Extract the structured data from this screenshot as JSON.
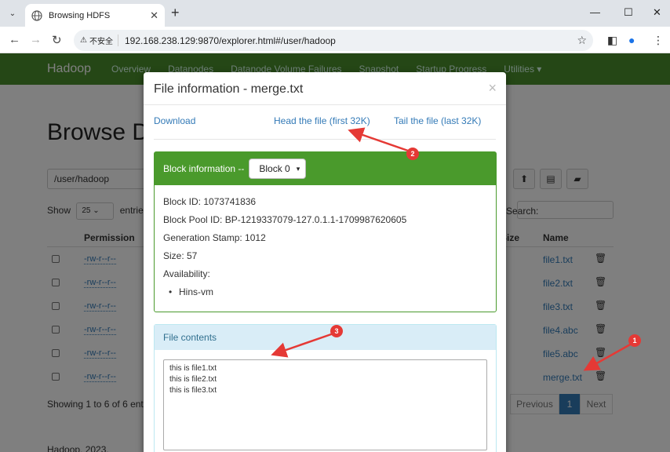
{
  "browser": {
    "tab_title": "Browsing HDFS",
    "new_tab": "+",
    "warning": "不安全",
    "url": "192.168.238.129:9870/explorer.html#/user/hadoop"
  },
  "navbar": {
    "brand": "Hadoop",
    "links": [
      "Overview",
      "Datanodes",
      "Datanode Volume Failures",
      "Snapshot",
      "Startup Progress",
      "Utilities ▾"
    ]
  },
  "page": {
    "title": "Browse Directory",
    "path": "/user/hadoop",
    "show_label": "Show",
    "show_value": "25",
    "entries_label": "entries",
    "search_label": "Search:",
    "col_permission": "Permission",
    "col_size": "Size",
    "col_name": "Name",
    "rows": [
      {
        "permission": "-rw-r--r--",
        "name": "file1.txt"
      },
      {
        "permission": "-rw-r--r--",
        "name": "file2.txt"
      },
      {
        "permission": "-rw-r--r--",
        "name": "file3.txt"
      },
      {
        "permission": "-rw-r--r--",
        "name": "file4.abc"
      },
      {
        "permission": "-rw-r--r--",
        "name": "file5.abc"
      },
      {
        "permission": "-rw-r--r--",
        "name": "merge.txt"
      }
    ],
    "showing": "Showing 1 to 6 of 6 entries",
    "prev": "Previous",
    "page_num": "1",
    "next": "Next",
    "footer": "Hadoop, 2023."
  },
  "modal": {
    "title": "File information - merge.txt",
    "close": "×",
    "download": "Download",
    "head": "Head the file (first 32K)",
    "tail": "Tail the file (last 32K)",
    "block_header": "Block information --",
    "block_select": "Block 0",
    "block_id": "Block ID: 1073741836",
    "block_pool": "Block Pool ID: BP-1219337079-127.0.1.1-1709987620605",
    "gen_stamp": "Generation Stamp: 1012",
    "size": "Size: 57",
    "availability": "Availability:",
    "avail_host": "Hins-vm",
    "contents_header": "File contents",
    "contents_text": "this is file1.txt\nthis is file2.txt\nthis is file3.txt"
  },
  "annotations": {
    "badge1": "1",
    "badge2": "2",
    "badge3": "3",
    "color": "#e53935"
  }
}
